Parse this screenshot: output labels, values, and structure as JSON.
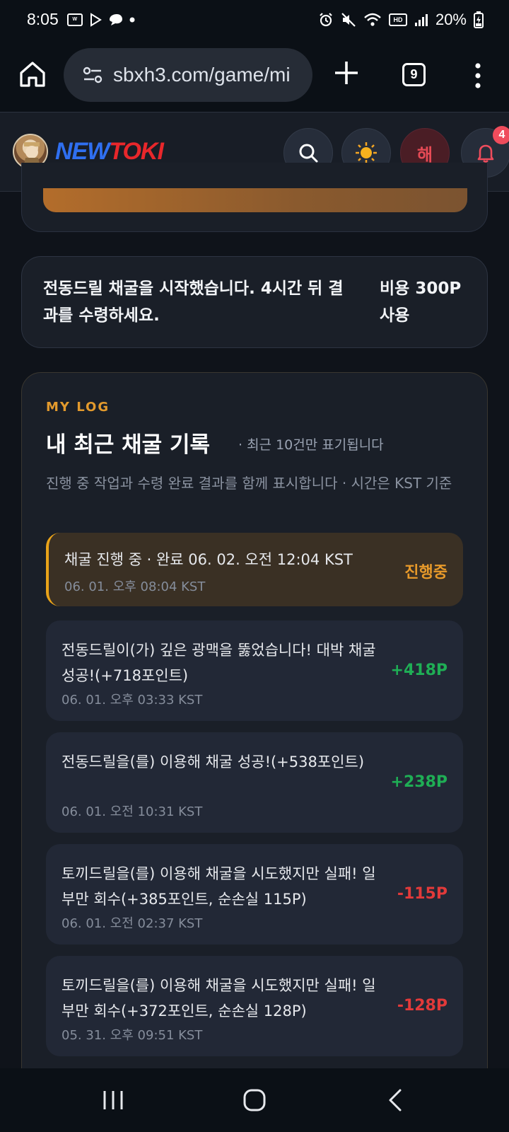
{
  "status_bar": {
    "time": "8:05",
    "battery": "20%",
    "hd_label": "HD"
  },
  "browser": {
    "url": "sbxh3.com/game/mi",
    "tab_count": "9"
  },
  "site": {
    "logo_new": "NEW",
    "logo_toki": "TOKI",
    "lang_button": "해",
    "notification_count": "4"
  },
  "notice": {
    "message": "전동드릴 채굴을 시작했습니다. 4시간 뒤 결과를 수령하세요.",
    "cost": "비용 300P 사용"
  },
  "log": {
    "kicker": "MY LOG",
    "title": "내 최근 채굴 기록",
    "note": "· 최근 10건만 표기됩니다",
    "description": "진행 중 작업과 수령 완료 결과를 함께 표시합니다 · 시간은 KST 기준",
    "entries": [
      {
        "message": "채굴 진행 중 · 완료 06. 02. 오전 12:04 KST",
        "time": "06. 01. 오후 08:04 KST",
        "amount": "진행중"
      },
      {
        "message": "전동드릴이(가) 깊은 광맥을 뚫었습니다! 대박 채굴 성공!(+718포인트)",
        "time": "06. 01. 오후 03:33 KST",
        "amount": "+418P"
      },
      {
        "message": "전동드릴을(를) 이용해 채굴 성공!(+538포인트)",
        "time": "06. 01. 오전 10:31 KST",
        "amount": "+238P"
      },
      {
        "message": "토끼드릴을(를) 이용해 채굴을 시도했지만 실패! 일부만 회수(+385포인트, 순손실 115P)",
        "time": "06. 01. 오전 02:37 KST",
        "amount": "-115P"
      },
      {
        "message": "토끼드릴을(를) 이용해 채굴을 시도했지만 실패! 일부만 회수(+372포인트, 순손실 128P)",
        "time": "05. 31. 오후 09:51 KST",
        "amount": "-128P"
      }
    ]
  },
  "colors": {
    "accent_orange": "#e39a2d",
    "positive": "#1fae55",
    "negative": "#e23a3a"
  }
}
